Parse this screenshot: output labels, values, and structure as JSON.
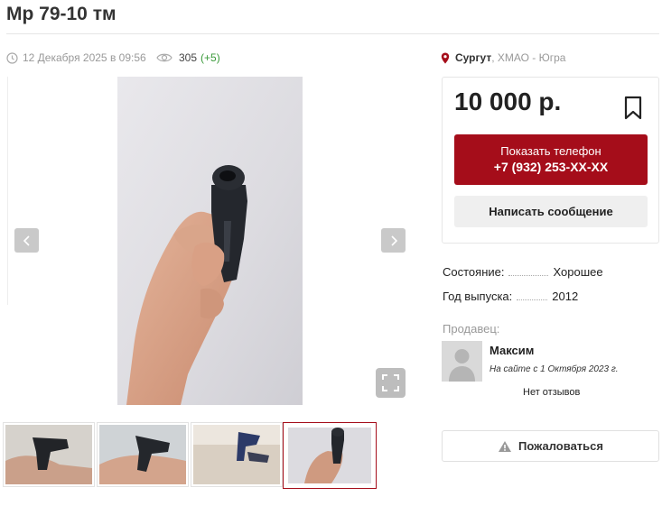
{
  "listing": {
    "title": "Мр 79-10 тм",
    "date": "12 Декабря 2025 в 09:56",
    "views": "305",
    "views_increase": "(+5)"
  },
  "location": {
    "city": "Сургут",
    "region": ", ХМАО - Югра"
  },
  "gallery": {
    "thumbnail_count": 4,
    "active_thumbnail": 4
  },
  "price": {
    "value": "10 000 р."
  },
  "contact": {
    "phone_label": "Показать телефон",
    "phone_number": "+7 (932) 253-XX-XX",
    "message_label": "Написать сообщение"
  },
  "specs": [
    {
      "key": "Состояние:",
      "value": "Хорошее"
    },
    {
      "key": "Год выпуска:",
      "value": "2012"
    }
  ],
  "seller": {
    "heading": "Продавец:",
    "name": "Максим",
    "since": "На сайте с 1 Октября 2023 г.",
    "reviews": "Нет отзывов"
  },
  "report": {
    "label": "Пожаловаться"
  },
  "colors": {
    "accent": "#a50d1a",
    "views_increase": "#3a9a3a",
    "muted": "#999999"
  },
  "icons": [
    "clock-icon",
    "eye-icon",
    "map-pin-icon",
    "bookmark-icon",
    "chevron-left-icon",
    "chevron-right-icon",
    "fullscreen-icon",
    "warning-icon",
    "avatar-placeholder-icon"
  ]
}
